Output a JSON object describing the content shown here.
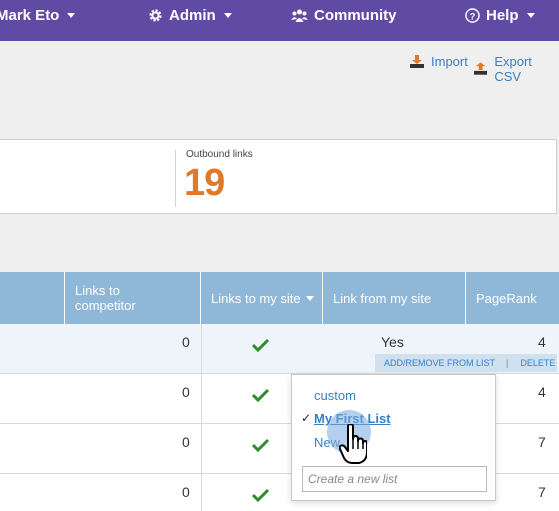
{
  "nav": {
    "user_label": "Mark Eto",
    "admin_label": "Admin",
    "community_label": "Community",
    "help_label": "Help"
  },
  "actions": {
    "import_label": "Import",
    "export_label": "Export CSV"
  },
  "stats": {
    "outbound_label": "Outbound links",
    "outbound_value": "19"
  },
  "table": {
    "headers": {
      "links_to_competitor": "Links to competitor",
      "links_to_my_site": "Links to my site",
      "link_from_my_site": "Link from my site",
      "pagerank": "PageRank"
    },
    "rows": [
      {
        "links_to_competitor": "0",
        "links_to_my_site": true,
        "link_from_my_site": "Yes",
        "pagerank": "4"
      },
      {
        "links_to_competitor": "0",
        "links_to_my_site": true,
        "link_from_my_site": "",
        "pagerank": "4"
      },
      {
        "links_to_competitor": "0",
        "links_to_my_site": true,
        "link_from_my_site": "",
        "pagerank": "7"
      },
      {
        "links_to_competitor": "0",
        "links_to_my_site": true,
        "link_from_my_site": "",
        "pagerank": "7"
      }
    ],
    "row_actions": {
      "add_remove_label": "ADD/REMOVE FROM LIST",
      "separator": "|",
      "delete_label": "DELETE"
    }
  },
  "list_dropdown": {
    "items": [
      "custom",
      "My First List",
      "New"
    ],
    "selected_mark": "✓",
    "new_list_placeholder": "Create a new list"
  },
  "colors": {
    "nav_bg": "#5f4ba3",
    "header_bg": "#8fb7d8",
    "accent_orange": "#e07a2a",
    "link_blue": "#3a7fc4",
    "check_green": "#2e8b2e"
  },
  "icons": {
    "admin": "gear-icon",
    "community": "people-icon",
    "help": "question-circle-icon",
    "import": "download-tray-icon",
    "export": "upload-tray-icon",
    "check": "checkmark-icon",
    "cursor": "hand-pointer-icon"
  }
}
